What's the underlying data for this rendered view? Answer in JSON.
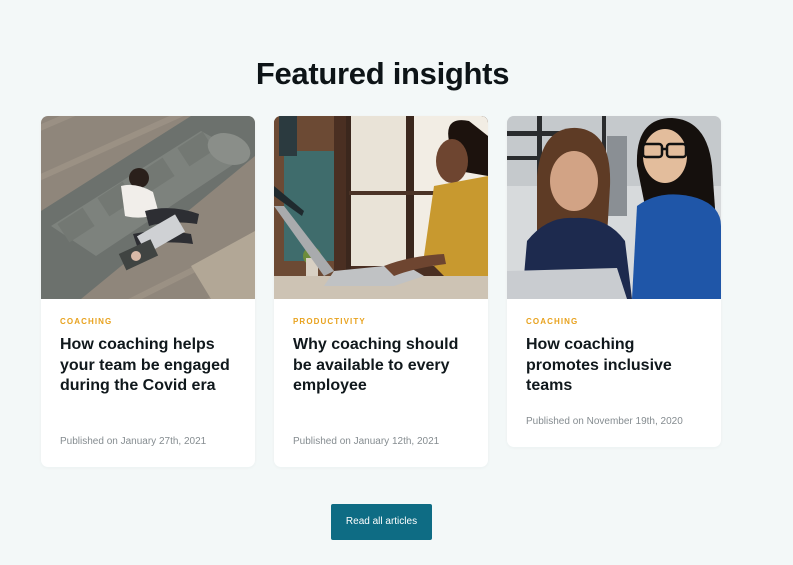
{
  "section": {
    "title": "Featured insights"
  },
  "articles": [
    {
      "category": "COACHING",
      "title": "How coaching helps your team be engaged during the Covid era",
      "published": "Published on January 27th, 2021",
      "image": "woman-working-on-laptop-on-sofa"
    },
    {
      "category": "PRODUCTIVITY",
      "title": "Why coaching should be available to every employee",
      "published": "Published on January 12th, 2021",
      "image": "woman-typing-on-laptop-by-window"
    },
    {
      "category": "COACHING",
      "title": "How coaching promotes inclusive teams",
      "published": "Published on November 19th, 2020",
      "image": "two-women-looking-at-laptop"
    }
  ],
  "cta": {
    "label": "Read all articles"
  },
  "colors": {
    "background": "#f3f8f8",
    "accent": "#e8a21e",
    "button": "#0e6c84"
  }
}
